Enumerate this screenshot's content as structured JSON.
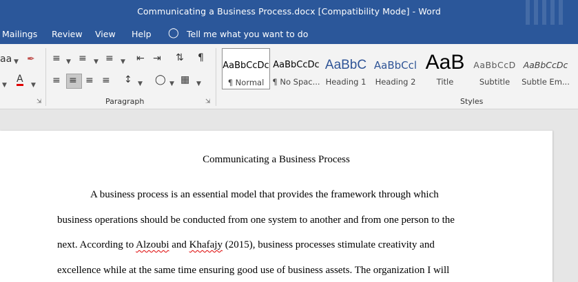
{
  "window": {
    "title": "Communicating a Business Process.docx [Compatibility Mode]  -  Word"
  },
  "tabs": [
    "Mailings",
    "Review",
    "View",
    "Help"
  ],
  "tell_me": {
    "icon": "lightbulb-icon",
    "text": "Tell me what you want to do"
  },
  "ribbon": {
    "font_group_partial": {
      "font_prefix": "aa"
    },
    "paragraph_label": "Paragraph",
    "styles_label": "Styles",
    "styles": [
      {
        "preview": "AaBbCcDc",
        "name": "¶ Normal",
        "selected": true,
        "color": "#000000"
      },
      {
        "preview": "AaBbCcDc",
        "name": "¶ No Spac...",
        "selected": false,
        "color": "#000000"
      },
      {
        "preview": "AaBbC",
        "name": "Heading 1",
        "selected": false,
        "color": "#2f5496"
      },
      {
        "preview": "AaBbCcl",
        "name": "Heading 2",
        "selected": false,
        "color": "#2f5496"
      },
      {
        "preview": "AaB",
        "name": "Title",
        "selected": false,
        "color": "#000000"
      },
      {
        "preview": "AaBbCcD",
        "name": "Subtitle",
        "selected": false,
        "color": "#595959"
      },
      {
        "preview": "AaBbCcDc",
        "name": "Subtle Em...",
        "selected": false,
        "color": "#404040"
      }
    ]
  },
  "document": {
    "title": "Communicating a Business Process",
    "lines": [
      "A business process is an essential model that provides the framework through which",
      "business operations should be conducted from one system to another and from one person to the",
      "excellence while at the same time ensuring good use of business assets. The organization I will"
    ],
    "line3": {
      "before": "next. According to ",
      "author1": "Alzoubi",
      "and": " and ",
      "author2": "Khafajy",
      "after": " (2015), business processes stimulate creativity and"
    }
  },
  "colors": {
    "titlebar": "#2b579a",
    "ribbon": "#f3f3f3",
    "heading": "#2f5496"
  }
}
